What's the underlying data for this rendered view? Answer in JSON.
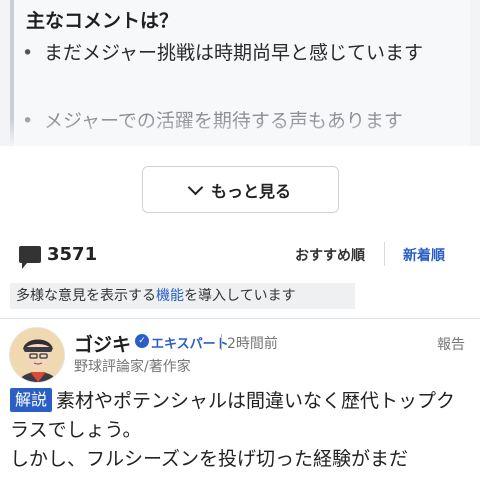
{
  "summary": {
    "title": "主なコメントは？",
    "bullets": [
      "まだメジャー挑戦は時期尚早と感じています",
      "メジャーでの活躍を期待する声もあります"
    ],
    "bullet_marker": "•"
  },
  "more_button": {
    "label": "もっと見る",
    "icon": "chevron-down-icon"
  },
  "comments_bar": {
    "count": "3571",
    "icon": "comment-bubble-icon",
    "sort_options": [
      "おすすめ順",
      "新着順"
    ],
    "active_sort": "新着順"
  },
  "notice": {
    "prefix": "多様な意見を表示する",
    "link": "機能",
    "suffix": "を導入しています"
  },
  "comment": {
    "author": "ゴジキ",
    "badge": "エキスパート",
    "time": "2時間前",
    "report": "報告",
    "title": "野球評論家/著作家",
    "tag": "解説",
    "text_line1": "素材やポテンシャルは間違いなく歴代トップク",
    "text_line2": "ラスでしょう。",
    "text_line3": "しかし、フルシーズンを投げ切った経験がまだ"
  },
  "colors": {
    "accent": "#2a5fc7",
    "muted": "#777777"
  }
}
